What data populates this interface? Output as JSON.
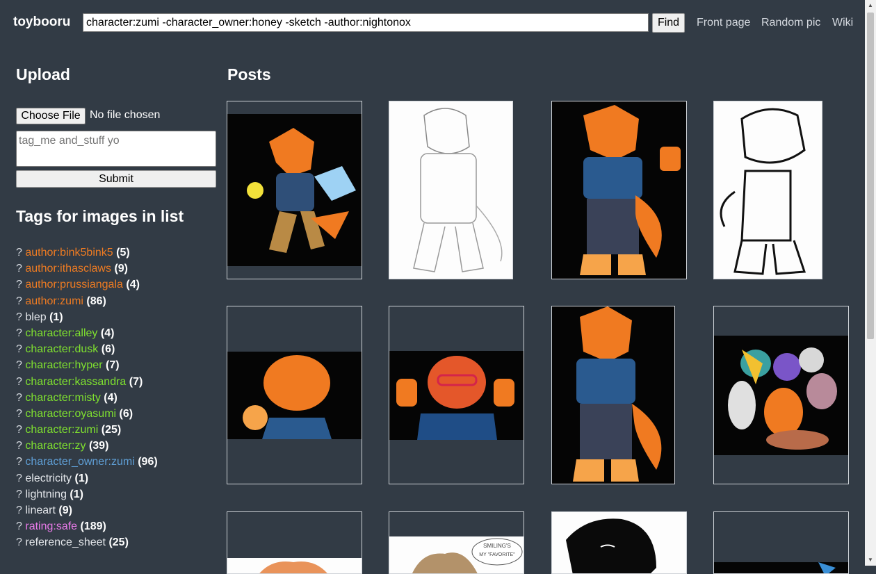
{
  "header": {
    "brand": "toybooru",
    "search_value": "character:zumi -character_owner:honey -sketch -author:nightonox",
    "find_label": "Find",
    "nav": [
      "Front page",
      "Random pic",
      "Wiki"
    ]
  },
  "upload": {
    "heading": "Upload",
    "choose_label": "Choose File",
    "no_file_label": "No file chosen",
    "tags_placeholder": "tag_me and_stuff yo",
    "submit_label": "Submit"
  },
  "tags": {
    "heading": "Tags for images in list",
    "question_mark": "?",
    "items": [
      {
        "name": "author:bink5bink5",
        "count": "(5)",
        "kind": "author"
      },
      {
        "name": "author:ithasclaws",
        "count": "(9)",
        "kind": "author"
      },
      {
        "name": "author:prussiangala",
        "count": "(4)",
        "kind": "author"
      },
      {
        "name": "author:zumi",
        "count": "(86)",
        "kind": "author"
      },
      {
        "name": "blep",
        "count": "(1)",
        "kind": "plain"
      },
      {
        "name": "character:alley",
        "count": "(4)",
        "kind": "character"
      },
      {
        "name": "character:dusk",
        "count": "(6)",
        "kind": "character"
      },
      {
        "name": "character:hyper",
        "count": "(7)",
        "kind": "character"
      },
      {
        "name": "character:kassandra",
        "count": "(7)",
        "kind": "character"
      },
      {
        "name": "character:misty",
        "count": "(4)",
        "kind": "character"
      },
      {
        "name": "character:oyasumi",
        "count": "(6)",
        "kind": "character"
      },
      {
        "name": "character:zumi",
        "count": "(25)",
        "kind": "character"
      },
      {
        "name": "character:zy",
        "count": "(39)",
        "kind": "character"
      },
      {
        "name": "character_owner:zumi",
        "count": "(96)",
        "kind": "owner"
      },
      {
        "name": "electricity",
        "count": "(1)",
        "kind": "plain"
      },
      {
        "name": "lightning",
        "count": "(1)",
        "kind": "plain"
      },
      {
        "name": "lineart",
        "count": "(9)",
        "kind": "plain"
      },
      {
        "name": "rating:safe",
        "count": "(189)",
        "kind": "rating"
      },
      {
        "name": "reference_sheet",
        "count": "(25)",
        "kind": "plain"
      }
    ]
  },
  "posts": {
    "heading": "Posts",
    "balloon_text_1": "SMILING'S",
    "balloon_text_2": "MY \"FAVORITE\""
  },
  "colors": {
    "page_bg": "#323b45",
    "author": "#ee7b22",
    "character": "#7fe12f",
    "owner": "#5f9fd6",
    "rating": "#e87ae8",
    "plain": "#e3e6ea"
  }
}
